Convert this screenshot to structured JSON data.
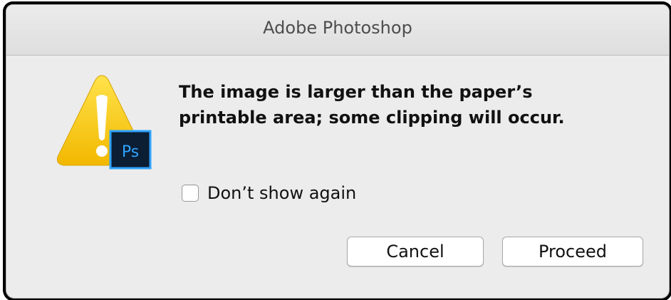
{
  "window": {
    "title": "Adobe Photoshop"
  },
  "alert": {
    "icon": "warning-triangle-with-photoshop-badge",
    "badge_text": "Ps",
    "message_line1": "The image is larger than the paper’s",
    "message_line2": "printable area; some clipping will occur."
  },
  "checkbox": {
    "label": "Don’t show again",
    "checked": false
  },
  "buttons": {
    "cancel": "Cancel",
    "proceed": "Proceed"
  },
  "colors": {
    "dialog_background": "#ececec",
    "warning_yellow": "#f6c400",
    "badge_background": "#0b1e33",
    "badge_text": "#2fa3ff"
  }
}
